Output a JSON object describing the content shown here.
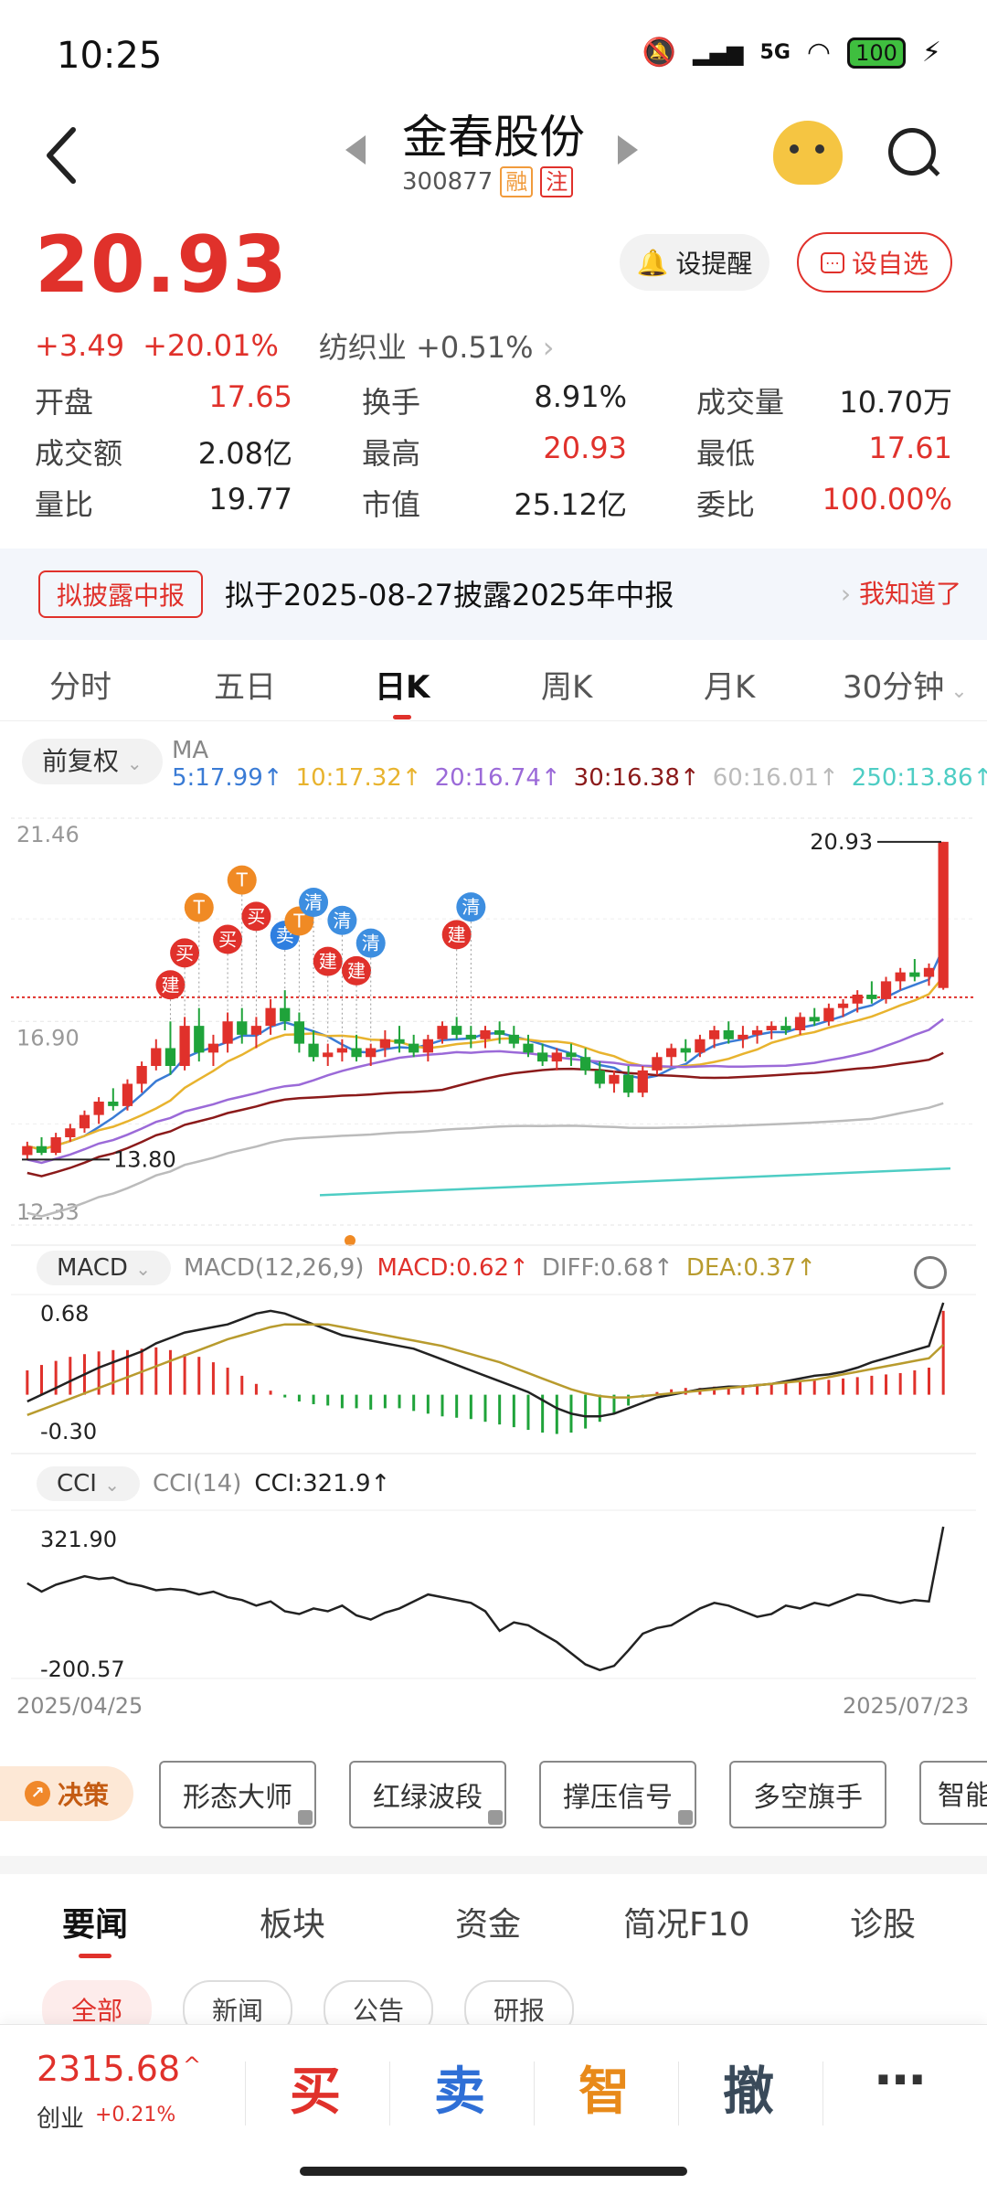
{
  "status_bar": {
    "time": "10:25",
    "network": "5G",
    "battery": "100"
  },
  "header": {
    "stock_name": "金春股份",
    "stock_code": "300877",
    "tag_margin": "融",
    "tag_note": "注"
  },
  "price": {
    "last": "20.93",
    "change": "+3.49",
    "change_pct": "+20.01%",
    "industry": "纺织业",
    "industry_pct": "+0.51%",
    "alert_label": "设提醒",
    "fav_label": "设自选"
  },
  "quotes": [
    [
      {
        "label": "开盘",
        "value": "17.65",
        "color": "red"
      },
      {
        "label": "换手",
        "value": "8.91%",
        "color": "dark"
      },
      {
        "label": "成交量",
        "value": "10.70万",
        "color": "dark"
      }
    ],
    [
      {
        "label": "成交额",
        "value": "2.08亿",
        "color": "dark"
      },
      {
        "label": "最高",
        "value": "20.93",
        "color": "red"
      },
      {
        "label": "最低",
        "value": "17.61",
        "color": "red"
      }
    ],
    [
      {
        "label": "量比",
        "value": "19.77",
        "color": "dark"
      },
      {
        "label": "市值",
        "value": "25.12亿",
        "color": "dark"
      },
      {
        "label": "委比",
        "value": "100.00%",
        "color": "red"
      }
    ]
  ],
  "notice": {
    "badge": "拟披露中报",
    "text": "拟于2025-08-27披露2025年中报",
    "dismiss": "我知道了"
  },
  "k_tabs": [
    "分时",
    "五日",
    "日K",
    "周K",
    "月K",
    "30分钟"
  ],
  "ma": {
    "adjust": "前复权",
    "prefix": "MA",
    "items": [
      {
        "text": "5:17.99↑",
        "color": "#3a7bd5"
      },
      {
        "text": "10:17.32↑",
        "color": "#e8b32e"
      },
      {
        "text": "20:16.74↑",
        "color": "#9b6ad8"
      },
      {
        "text": "30:16.38↑",
        "color": "#8b1a1a"
      },
      {
        "text": "60:16.01↑",
        "color": "#bbbbbb"
      },
      {
        "text": "250:13.86↑",
        "color": "#4ecdc4"
      }
    ]
  },
  "chart_data": [
    {
      "type": "candlestick",
      "title": "",
      "ylim": [
        12.33,
        21.46
      ],
      "y_ticks": [
        "21.46",
        "16.90",
        "12.33"
      ],
      "high_label": "20.93",
      "low_label": "13.80",
      "x_range": [
        "2025/04/25",
        "2025/07/23"
      ],
      "candles": [
        [
          13.9,
          14.2,
          13.8,
          14.1
        ],
        [
          14.1,
          14.3,
          13.9,
          13.95
        ],
        [
          13.95,
          14.4,
          13.9,
          14.3
        ],
        [
          14.3,
          14.6,
          14.2,
          14.5
        ],
        [
          14.5,
          14.9,
          14.4,
          14.8
        ],
        [
          14.8,
          15.2,
          14.6,
          15.1
        ],
        [
          15.1,
          15.4,
          14.9,
          15.0
        ],
        [
          15.0,
          15.6,
          14.9,
          15.5
        ],
        [
          15.5,
          16.0,
          15.3,
          15.9
        ],
        [
          15.9,
          16.5,
          15.8,
          16.3
        ],
        [
          16.3,
          16.9,
          15.7,
          15.9
        ],
        [
          15.9,
          17.0,
          15.8,
          16.8
        ],
        [
          16.8,
          17.2,
          16.0,
          16.2
        ],
        [
          16.2,
          16.6,
          15.9,
          16.4
        ],
        [
          16.4,
          17.1,
          16.2,
          16.9
        ],
        [
          16.9,
          17.2,
          16.4,
          16.6
        ],
        [
          16.6,
          17.0,
          16.3,
          16.8
        ],
        [
          16.8,
          17.4,
          16.6,
          17.2
        ],
        [
          17.2,
          17.6,
          16.7,
          16.9
        ],
        [
          16.9,
          17.1,
          16.2,
          16.4
        ],
        [
          16.4,
          16.7,
          16.0,
          16.1
        ],
        [
          16.1,
          16.4,
          15.9,
          16.2
        ],
        [
          16.2,
          16.5,
          16.0,
          16.3
        ],
        [
          16.3,
          16.6,
          16.0,
          16.1
        ],
        [
          16.1,
          16.4,
          15.9,
          16.3
        ],
        [
          16.3,
          16.7,
          16.1,
          16.5
        ],
        [
          16.5,
          16.8,
          16.2,
          16.4
        ],
        [
          16.4,
          16.6,
          16.1,
          16.2
        ],
        [
          16.2,
          16.6,
          16.0,
          16.5
        ],
        [
          16.5,
          16.9,
          16.4,
          16.8
        ],
        [
          16.8,
          17.0,
          16.5,
          16.6
        ],
        [
          16.6,
          16.8,
          16.3,
          16.5
        ],
        [
          16.5,
          16.8,
          16.3,
          16.7
        ],
        [
          16.7,
          16.9,
          16.4,
          16.6
        ],
        [
          16.6,
          16.8,
          16.3,
          16.4
        ],
        [
          16.4,
          16.6,
          16.1,
          16.2
        ],
        [
          16.2,
          16.4,
          15.9,
          16.0
        ],
        [
          16.0,
          16.3,
          15.8,
          16.2
        ],
        [
          16.2,
          16.4,
          15.9,
          16.1
        ],
        [
          16.1,
          16.3,
          15.7,
          15.8
        ],
        [
          15.8,
          16.0,
          15.4,
          15.5
        ],
        [
          15.5,
          15.8,
          15.3,
          15.7
        ],
        [
          15.7,
          15.9,
          15.2,
          15.3
        ],
        [
          15.3,
          15.9,
          15.2,
          15.8
        ],
        [
          15.8,
          16.2,
          15.7,
          16.1
        ],
        [
          16.1,
          16.4,
          15.9,
          16.3
        ],
        [
          16.3,
          16.5,
          16.0,
          16.2
        ],
        [
          16.2,
          16.6,
          16.1,
          16.5
        ],
        [
          16.5,
          16.8,
          16.3,
          16.7
        ],
        [
          16.7,
          16.9,
          16.4,
          16.5
        ],
        [
          16.5,
          16.8,
          16.3,
          16.6
        ],
        [
          16.6,
          16.8,
          16.4,
          16.7
        ],
        [
          16.7,
          16.9,
          16.5,
          16.8
        ],
        [
          16.8,
          17.0,
          16.6,
          16.7
        ],
        [
          16.7,
          17.1,
          16.6,
          17.0
        ],
        [
          17.0,
          17.2,
          16.8,
          16.9
        ],
        [
          16.9,
          17.3,
          16.8,
          17.2
        ],
        [
          17.2,
          17.4,
          17.0,
          17.3
        ],
        [
          17.3,
          17.6,
          17.1,
          17.5
        ],
        [
          17.5,
          17.8,
          17.3,
          17.4
        ],
        [
          17.4,
          17.9,
          17.3,
          17.8
        ],
        [
          17.8,
          18.1,
          17.6,
          18.0
        ],
        [
          18.0,
          18.3,
          17.8,
          17.9
        ],
        [
          17.9,
          18.2,
          17.7,
          18.1
        ],
        [
          17.65,
          20.93,
          17.61,
          20.93
        ]
      ],
      "trade_markers": [
        {
          "label": "建",
          "kind": "build",
          "index": 10
        },
        {
          "label": "买",
          "kind": "buy",
          "index": 11
        },
        {
          "label": "T",
          "kind": "t",
          "index": 12
        },
        {
          "label": "买",
          "kind": "buy",
          "index": 14
        },
        {
          "label": "T",
          "kind": "t",
          "index": 15
        },
        {
          "label": "买",
          "kind": "buy",
          "index": 16
        },
        {
          "label": "卖",
          "kind": "sell",
          "index": 18
        },
        {
          "label": "T",
          "kind": "t",
          "index": 19
        },
        {
          "label": "清",
          "kind": "clear",
          "index": 20
        },
        {
          "label": "建",
          "kind": "build",
          "index": 21
        },
        {
          "label": "清",
          "kind": "clear",
          "index": 22
        },
        {
          "label": "建",
          "kind": "build",
          "index": 23
        },
        {
          "label": "清",
          "kind": "clear",
          "index": 24
        },
        {
          "label": "建",
          "kind": "build",
          "index": 30
        },
        {
          "label": "清",
          "kind": "clear",
          "index": 31
        }
      ]
    },
    {
      "type": "bar",
      "title": "MACD(12,26,9)",
      "ylim": [
        -0.3,
        0.68
      ],
      "macd_label": "MACD:0.62↑",
      "diff_label": "DIFF:0.68↑",
      "dea_label": "DEA:0.37↑",
      "macd": [
        0.18,
        0.22,
        0.25,
        0.28,
        0.3,
        0.32,
        0.33,
        0.33,
        0.34,
        0.35,
        0.33,
        0.3,
        0.28,
        0.24,
        0.2,
        0.14,
        0.08,
        0.03,
        -0.02,
        -0.05,
        -0.07,
        -0.08,
        -0.1,
        -0.1,
        -0.11,
        -0.1,
        -0.1,
        -0.12,
        -0.14,
        -0.16,
        -0.17,
        -0.18,
        -0.2,
        -0.22,
        -0.24,
        -0.26,
        -0.28,
        -0.29,
        -0.28,
        -0.25,
        -0.2,
        -0.14,
        -0.08,
        -0.02,
        0.02,
        0.04,
        0.05,
        0.05,
        0.06,
        0.06,
        0.07,
        0.08,
        0.08,
        0.09,
        0.1,
        0.11,
        0.11,
        0.12,
        0.13,
        0.14,
        0.15,
        0.16,
        0.18,
        0.2,
        0.62
      ],
      "diff": [
        -0.05,
        0.0,
        0.05,
        0.1,
        0.15,
        0.2,
        0.24,
        0.28,
        0.32,
        0.38,
        0.42,
        0.46,
        0.48,
        0.5,
        0.52,
        0.56,
        0.6,
        0.62,
        0.6,
        0.56,
        0.52,
        0.48,
        0.44,
        0.42,
        0.4,
        0.38,
        0.36,
        0.34,
        0.3,
        0.26,
        0.22,
        0.18,
        0.14,
        0.1,
        0.06,
        0.02,
        -0.04,
        -0.1,
        -0.14,
        -0.16,
        -0.16,
        -0.14,
        -0.1,
        -0.06,
        -0.02,
        0.0,
        0.02,
        0.04,
        0.05,
        0.06,
        0.06,
        0.07,
        0.08,
        0.1,
        0.12,
        0.14,
        0.15,
        0.17,
        0.2,
        0.24,
        0.27,
        0.3,
        0.33,
        0.36,
        0.68
      ],
      "dea": [
        -0.15,
        -0.11,
        -0.07,
        -0.03,
        0.01,
        0.05,
        0.09,
        0.13,
        0.17,
        0.21,
        0.25,
        0.29,
        0.33,
        0.37,
        0.41,
        0.44,
        0.47,
        0.5,
        0.52,
        0.52,
        0.52,
        0.52,
        0.5,
        0.48,
        0.46,
        0.44,
        0.42,
        0.4,
        0.38,
        0.36,
        0.33,
        0.3,
        0.27,
        0.24,
        0.2,
        0.16,
        0.12,
        0.08,
        0.04,
        0.01,
        -0.01,
        -0.02,
        -0.02,
        -0.01,
        0.0,
        0.01,
        0.02,
        0.03,
        0.04,
        0.05,
        0.06,
        0.07,
        0.08,
        0.09,
        0.1,
        0.11,
        0.13,
        0.15,
        0.17,
        0.19,
        0.21,
        0.23,
        0.25,
        0.27,
        0.37
      ]
    },
    {
      "type": "line",
      "title": "CCI(14)",
      "ylim": [
        -200.57,
        321.9
      ],
      "cci_label": "CCI:321.9↑",
      "values": [
        120,
        90,
        115,
        130,
        145,
        135,
        140,
        120,
        110,
        95,
        100,
        95,
        80,
        90,
        70,
        60,
        40,
        55,
        20,
        10,
        30,
        20,
        40,
        5,
        -10,
        15,
        30,
        55,
        80,
        70,
        60,
        50,
        20,
        -50,
        -20,
        -30,
        -60,
        -90,
        -130,
        -170,
        -190,
        -175,
        -120,
        -60,
        -40,
        -30,
        0,
        30,
        50,
        40,
        20,
        0,
        10,
        40,
        30,
        50,
        40,
        60,
        80,
        75,
        60,
        50,
        60,
        55,
        321.9
      ]
    }
  ],
  "tools": {
    "decision": "决策",
    "items": [
      "形态大师",
      "红绿波段",
      "撑压信号",
      "多空旗手",
      "智能"
    ]
  },
  "news_tabs": [
    "要闻",
    "板块",
    "资金",
    "简况F10",
    "诊股"
  ],
  "news_chips": [
    "全部",
    "新闻",
    "公告",
    "研报"
  ],
  "bottom": {
    "index_value": "2315.68",
    "index_name": "创业",
    "index_change": "+0.21%",
    "actions": [
      {
        "label": "买",
        "color": "#e0312b"
      },
      {
        "label": "卖",
        "color": "#2f6fd6"
      },
      {
        "label": "智",
        "color": "#e88a1a"
      },
      {
        "label": "撤",
        "color": "#3a4a5a"
      }
    ],
    "more": "⋯"
  },
  "colors": {
    "up": "#e0312b",
    "down": "#1fa33a",
    "accent": "#e0312b"
  }
}
